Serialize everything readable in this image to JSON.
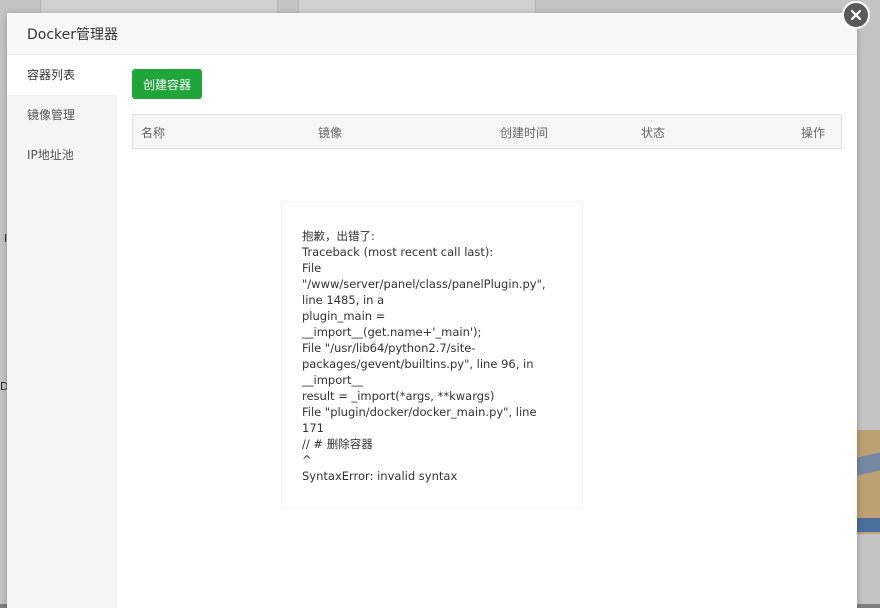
{
  "window": {
    "title": "Docker管理器"
  },
  "sidebar": {
    "items": [
      {
        "label": "容器列表"
      },
      {
        "label": "镜像管理"
      },
      {
        "label": "IP地址池"
      }
    ]
  },
  "toolbar": {
    "create_label": "创建容器"
  },
  "table": {
    "columns": [
      "名称",
      "镜像",
      "创建时间",
      "状态",
      "操作"
    ]
  },
  "error": {
    "text": "抱歉，出错了:\nTraceback (most recent call last):\nFile\n\"/www/server/panel/class/panelPlugin.py\",\nline 1485, in a\nplugin_main =\n__import__(get.name+'_main');\nFile \"/usr/lib64/python2.7/site-\npackages/gevent/builtins.py\", line 96, in\n__import__\nresult = _import(*args, **kwargs)\nFile \"plugin/docker/docker_main.py\", line\n171\n// # 删除容器\n^\nSyntaxError: invalid syntax"
  },
  "background": {
    "edge_text_1": "I",
    "edge_text_2": "D"
  },
  "colors": {
    "primary_button": "#20a53a",
    "close_button": "#5a5a5a"
  },
  "icons": {
    "close": "close-icon"
  }
}
